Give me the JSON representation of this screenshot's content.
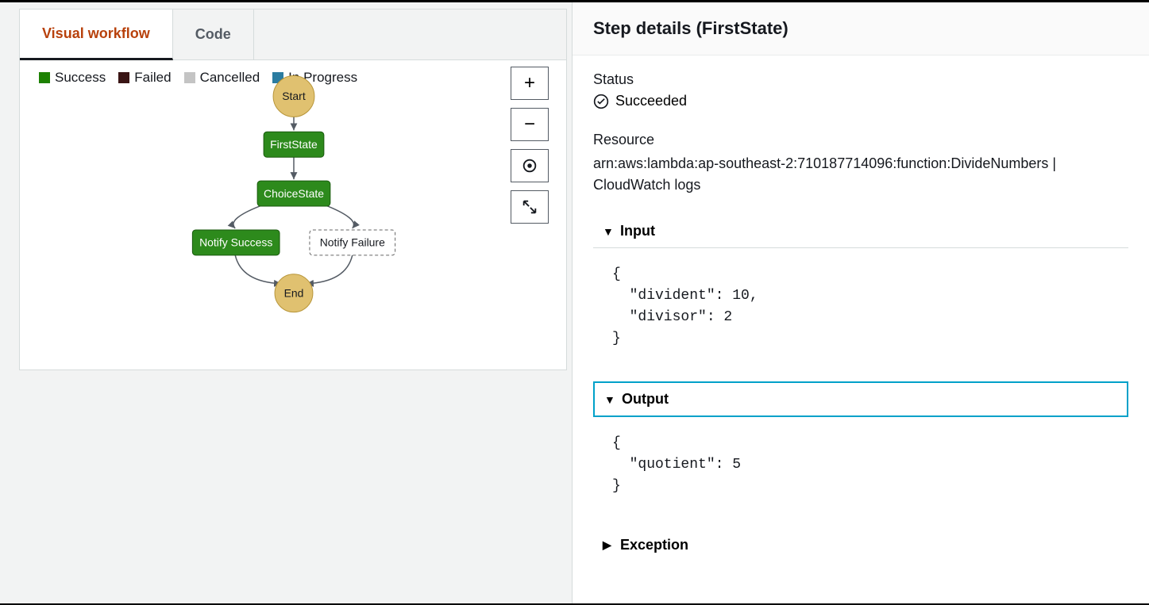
{
  "tabs": {
    "visual": "Visual workflow",
    "code": "Code"
  },
  "legend": {
    "success": "Success",
    "failed": "Failed",
    "cancelled": "Cancelled",
    "inprogress": "In Progress"
  },
  "nodes": {
    "start": "Start",
    "firstState": "FirstState",
    "choiceState": "ChoiceState",
    "notifySuccess": "Notify Success",
    "notifyFailure": "Notify Failure",
    "end": "End"
  },
  "details": {
    "title": "Step details (FirstState)",
    "statusLabel": "Status",
    "statusValue": "Succeeded",
    "resourceLabel": "Resource",
    "resourceValue": "arn:aws:lambda:ap-southeast-2:710187714096:function:DivideNumbers | CloudWatch logs",
    "inputLabel": "Input",
    "inputCode": "{\n  \"divident\": 10,\n  \"divisor\": 2\n}",
    "outputLabel": "Output",
    "outputCode": "{\n  \"quotient\": 5\n}",
    "exceptionLabel": "Exception"
  }
}
